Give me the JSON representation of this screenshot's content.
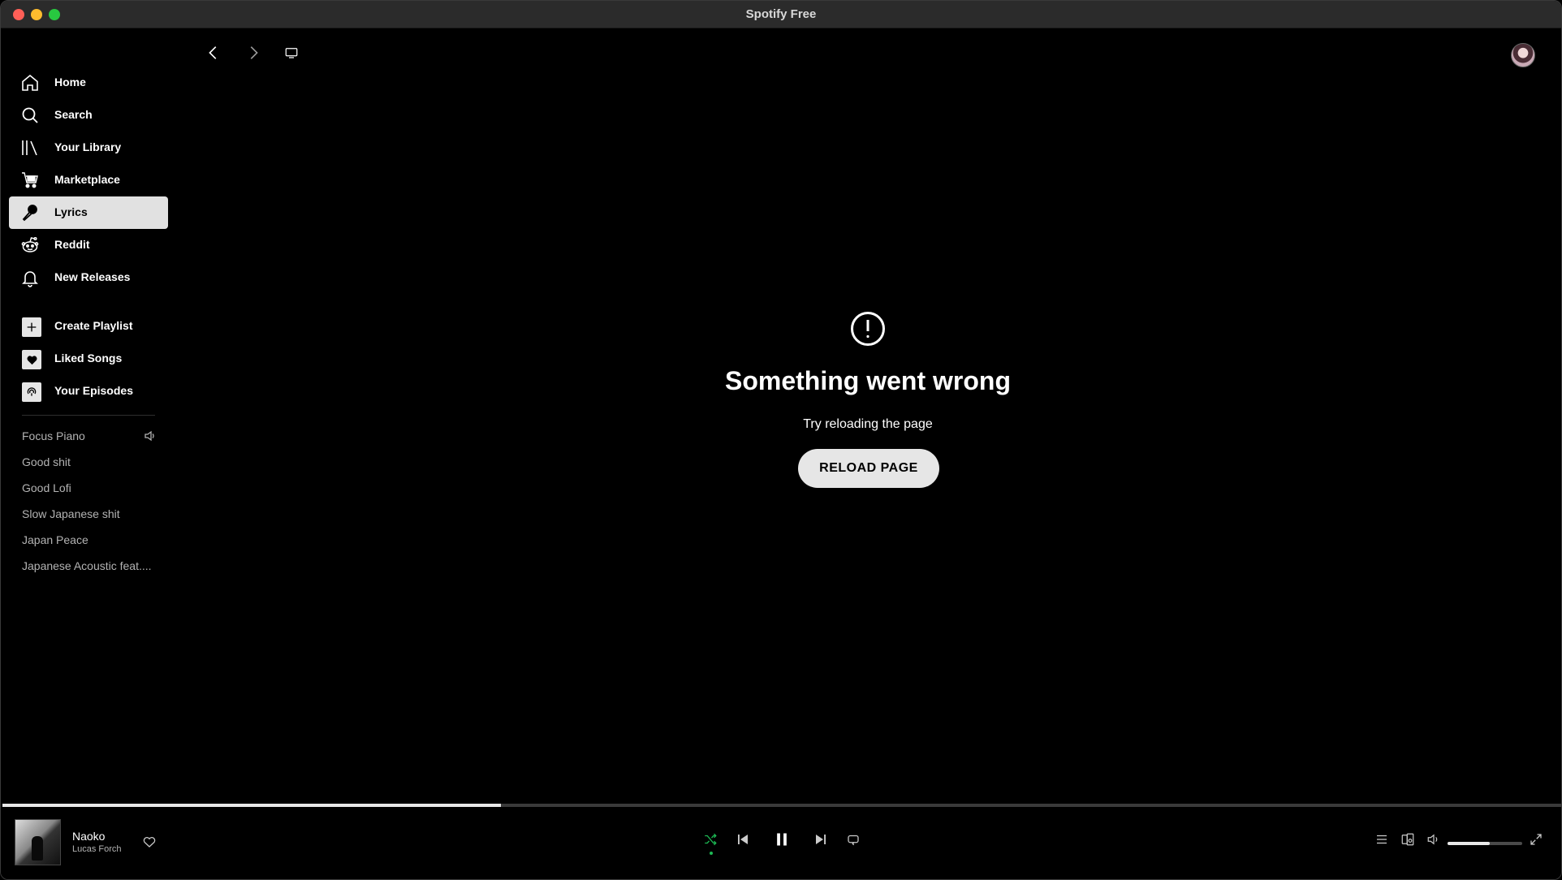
{
  "window": {
    "title": "Spotify Free"
  },
  "sidebar": {
    "nav": [
      {
        "label": "Home",
        "icon": "home-icon"
      },
      {
        "label": "Search",
        "icon": "search-icon"
      },
      {
        "label": "Your Library",
        "icon": "library-icon"
      },
      {
        "label": "Marketplace",
        "icon": "cart-icon"
      },
      {
        "label": "Lyrics",
        "icon": "microphone-icon",
        "active": true
      },
      {
        "label": "Reddit",
        "icon": "reddit-icon"
      },
      {
        "label": "New Releases",
        "icon": "bell-icon"
      }
    ],
    "actions": [
      {
        "label": "Create Playlist",
        "icon": "plus-icon"
      },
      {
        "label": "Liked Songs",
        "icon": "heart-icon"
      },
      {
        "label": "Your Episodes",
        "icon": "podcast-icon"
      }
    ],
    "playlists": [
      "Focus Piano",
      "Good shit",
      "Good Lofi",
      "Slow Japanese shit",
      "Japan Peace",
      "Japanese Acoustic feat...."
    ]
  },
  "main": {
    "error_title": "Something went wrong",
    "error_subtitle": "Try reloading the page",
    "reload_label": "RELOAD PAGE"
  },
  "player": {
    "track_title": "Naoko",
    "track_artist": "Lucas Forch",
    "progress_fraction": 0.32,
    "volume_fraction": 0.57,
    "shuffle_active": true
  },
  "colors": {
    "accent_green": "#1db954",
    "background": "#000000",
    "active_item_bg": "#e1e1e1"
  }
}
